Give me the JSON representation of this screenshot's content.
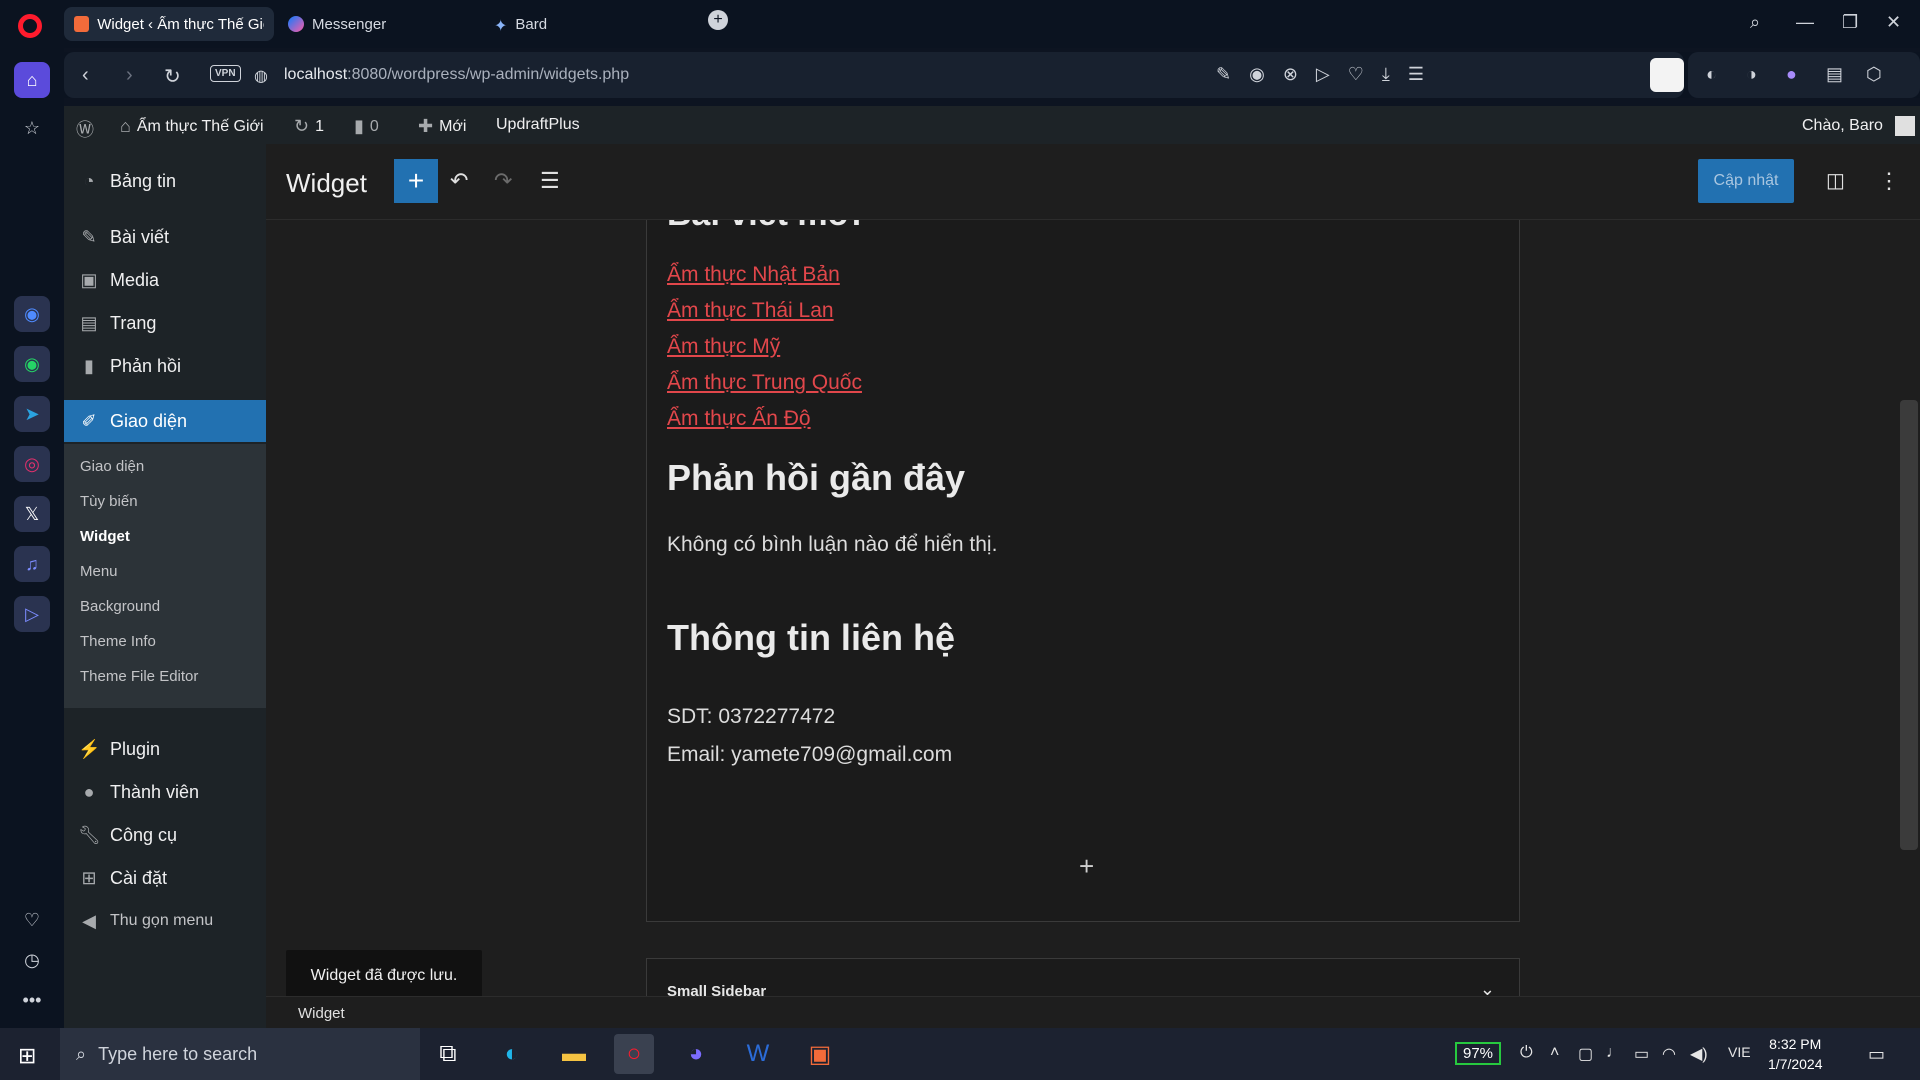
{
  "browser": {
    "tabs": [
      {
        "label": "Widget ‹ Ẩm thực Thế Giớ",
        "active": true
      },
      {
        "label": "Messenger",
        "active": false
      },
      {
        "label": "Bard",
        "active": false
      }
    ],
    "new_tab_symbol": "+",
    "url_host": "localhost",
    "url_rest": ":8080/wordpress/wp-admin/widgets.php",
    "vpn_label": "VPN"
  },
  "admin_bar": {
    "site_name": "Ẩm thực Thế Giới",
    "updates_count": "1",
    "comments_count": "0",
    "new_label": "Mới",
    "updraft_label": "UpdraftPlus",
    "greeting": "Chào, Baro"
  },
  "menu": {
    "items": [
      {
        "label": "Bảng tin",
        "icon": "dashboard-icon"
      },
      {
        "label": "Bài viết",
        "icon": "pin-icon"
      },
      {
        "label": "Media",
        "icon": "media-icon"
      },
      {
        "label": "Trang",
        "icon": "page-icon"
      },
      {
        "label": "Phản hồi",
        "icon": "comment-icon"
      },
      {
        "label": "Giao diện",
        "icon": "brush-icon"
      }
    ],
    "submenu": [
      "Giao diện",
      "Tùy biến",
      "Widget",
      "Menu",
      "Background",
      "Theme Info",
      "Theme File Editor"
    ],
    "lower_items": [
      {
        "label": "Plugin",
        "icon": "plugin-icon"
      },
      {
        "label": "Thành viên",
        "icon": "user-icon"
      },
      {
        "label": "Công cụ",
        "icon": "wrench-icon"
      },
      {
        "label": "Cài đặt",
        "icon": "settings-icon"
      }
    ],
    "collapse_label": "Thu gọn menu"
  },
  "editor": {
    "title": "Widget",
    "update_label": "Cập nhật",
    "cut_heading": "Bài viết mới",
    "recent_posts": [
      "Ẩm thực Nhật Bản",
      "Ẩm thực Thái Lan",
      "Ẩm thực Mỹ",
      "Ẩm thực Trung Quốc",
      "Ẩm thực Ấn Độ"
    ],
    "comments_heading": "Phản hồi gần đây",
    "no_comments": "Không có bình luận nào để hiển thị.",
    "contact_heading": "Thông tin  liên hệ",
    "phone": "SDT: 0372277472",
    "email": "Email: yamete709@gmail.com",
    "small_sidebar": "Small Sidebar",
    "snackbar": "Widget đã được lưu.",
    "breadcrumb": "Widget"
  },
  "taskbar": {
    "search_placeholder": "Type here to search",
    "battery": "97%",
    "language": "VIE",
    "time": "8:32 PM",
    "date": "1/7/2024"
  },
  "colors": {
    "wp_accent": "#2271b1",
    "link_red": "#e2474b",
    "opera_red": "#ff1b2d"
  }
}
